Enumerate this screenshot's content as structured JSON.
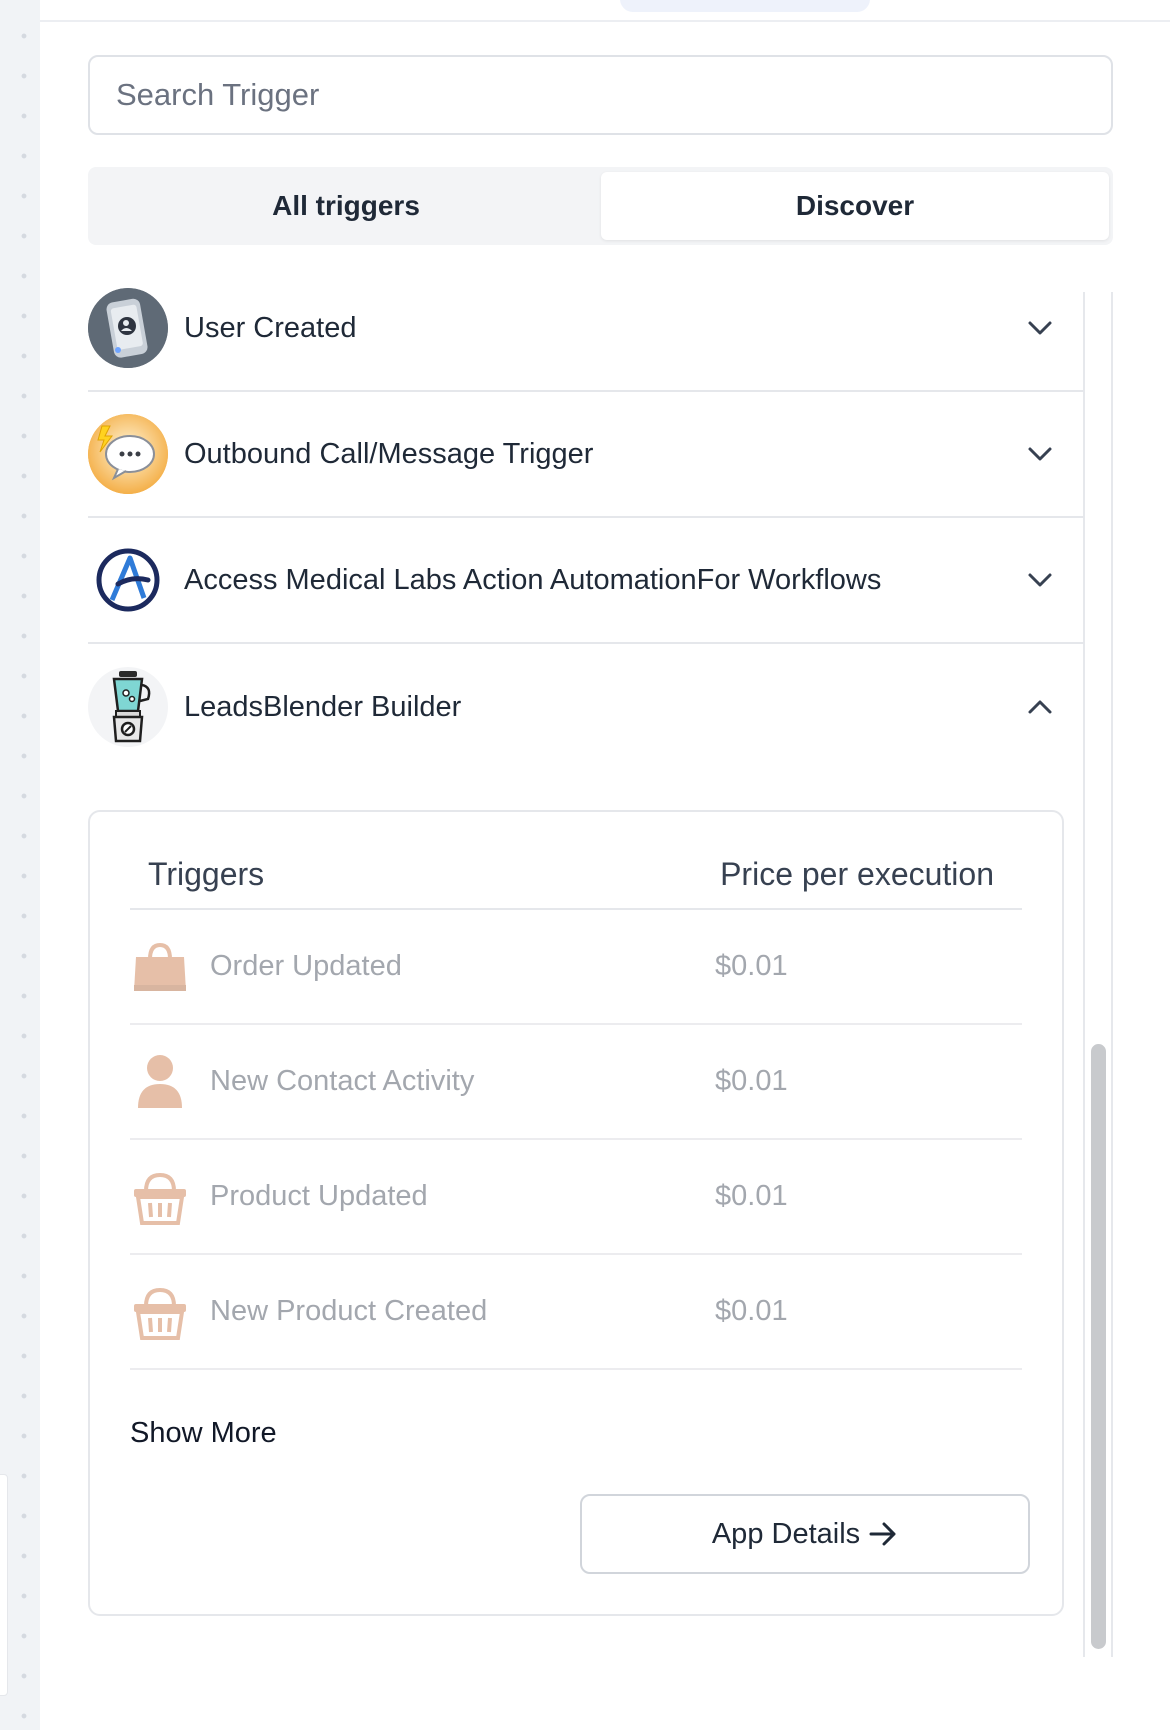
{
  "search": {
    "placeholder": "Search Trigger"
  },
  "tabs": [
    {
      "label": "All triggers",
      "active": false
    },
    {
      "label": "Discover",
      "active": true
    }
  ],
  "apps": [
    {
      "name": "User Created",
      "icon": "phone-user-logo",
      "expanded": false
    },
    {
      "name": "Outbound Call/Message Trigger",
      "icon": "chat-bubble-lightning-logo",
      "expanded": false
    },
    {
      "name": "Access Medical Labs Action AutomationFor Workflows",
      "icon": "letter-a-circle-logo",
      "expanded": false
    },
    {
      "name": "LeadsBlender Builder",
      "icon": "blender-logo",
      "expanded": true
    }
  ],
  "details": {
    "col_triggers": "Triggers",
    "col_price": "Price per execution",
    "triggers": [
      {
        "name": "Order Updated",
        "price": "$0.01",
        "icon": "shopping-bag-icon"
      },
      {
        "name": "New Contact Activity",
        "price": "$0.01",
        "icon": "person-icon"
      },
      {
        "name": "Product Updated",
        "price": "$0.01",
        "icon": "basket-icon"
      },
      {
        "name": "New Product Created",
        "price": "$0.01",
        "icon": "basket-icon"
      }
    ],
    "show_more": "Show More",
    "app_details_button": "App Details"
  },
  "colors": {
    "trigger_icon": "#c8733f",
    "muted_text": "#a3a7ae",
    "border": "#e5e7eb",
    "segment_bg": "#f3f4f6"
  }
}
